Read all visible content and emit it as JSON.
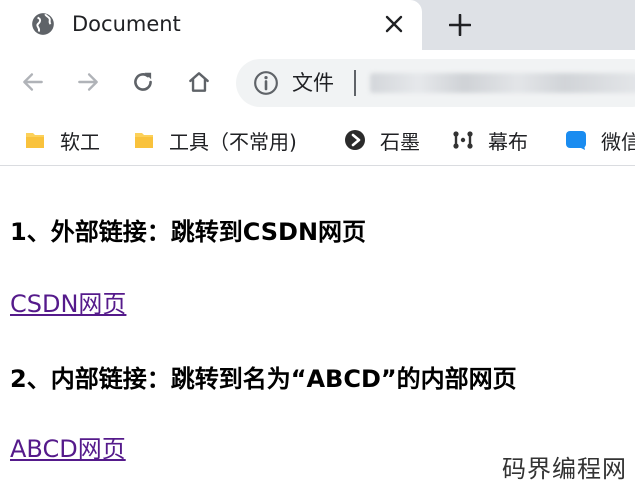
{
  "browser": {
    "tab": {
      "title": "Document",
      "favicon": "globe-icon"
    },
    "icons": {
      "close": "close-icon",
      "new_tab": "plus-icon",
      "back": "back-arrow-icon",
      "forward": "forward-arrow-icon",
      "reload": "reload-icon",
      "home": "home-icon",
      "info": "info-icon"
    },
    "address": {
      "scheme_label": "文件"
    },
    "bookmarks": [
      {
        "label": "软工",
        "icon": "folder-icon"
      },
      {
        "label": "工具（不常用)",
        "icon": "folder-icon"
      },
      {
        "label": "石墨",
        "icon": "shimo-icon"
      },
      {
        "label": "幕布",
        "icon": "mubu-icon"
      },
      {
        "label": "微信",
        "icon": "wechat-icon"
      }
    ]
  },
  "page": {
    "heading1": "1、外部链接：跳转到CSDN网页",
    "link1": "CSDN网页",
    "heading2": "2、内部链接：跳转到名为“ABCD”的内部网页",
    "link2": "ABCD网页"
  },
  "watermark": "码界编程网",
  "colors": {
    "tabstrip": "#dee1e6",
    "omnibox": "#f1f3f4",
    "icon": "#5f6368",
    "link_visited": "#551a8b",
    "folder": "#fcd15a",
    "wechat": "#1a8cf0"
  }
}
